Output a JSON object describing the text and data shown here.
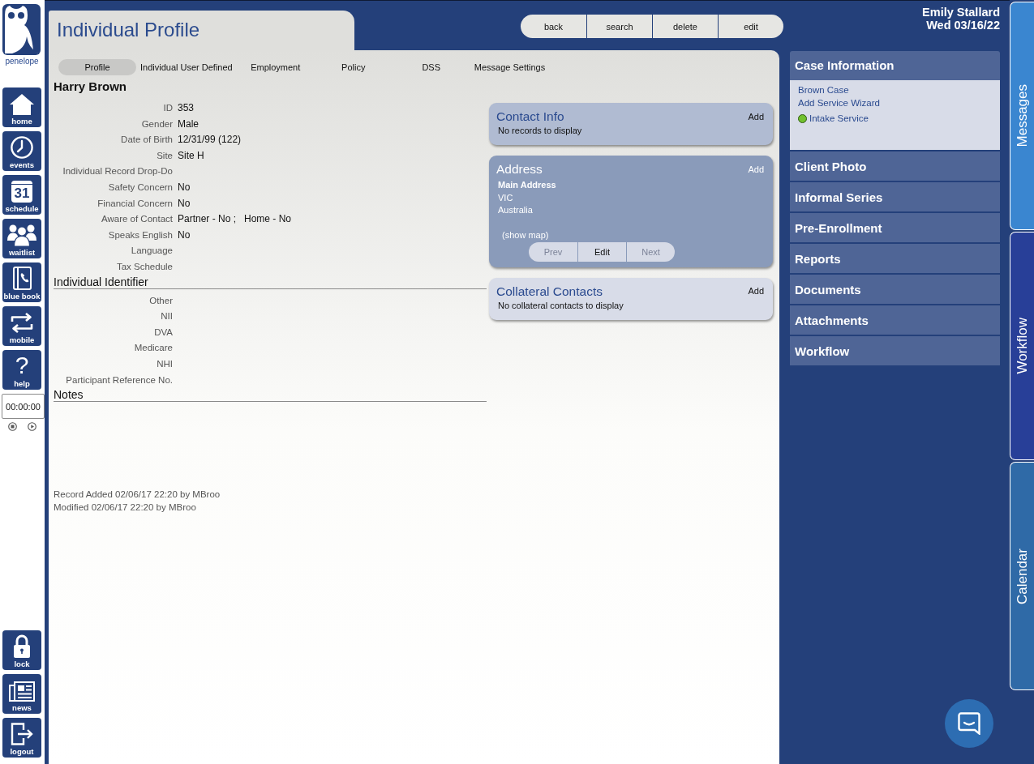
{
  "sidebar": {
    "logo_text": "penelope",
    "nav_items": [
      {
        "label": "home"
      },
      {
        "label": "events"
      },
      {
        "label": "schedule",
        "icon_text": "31"
      },
      {
        "label": "waitlist"
      },
      {
        "label": "blue book"
      },
      {
        "label": "mobile"
      },
      {
        "label": "help",
        "icon_text": "?"
      }
    ],
    "timer": {
      "value": "00:00:00"
    },
    "bottom_items": [
      {
        "label": "lock"
      },
      {
        "label": "news"
      },
      {
        "label": "logout"
      }
    ]
  },
  "header": {
    "title": "Individual Profile",
    "buttons": [
      "back",
      "search",
      "delete",
      "edit"
    ],
    "user_name": "Emily Stallard",
    "date": "Wed 03/16/22"
  },
  "profile": {
    "tabs": [
      {
        "label": "Profile",
        "selected": true
      },
      {
        "label": "Individual User Defined",
        "selected": false
      },
      {
        "label": "Employment",
        "selected": false
      },
      {
        "label": "Policy",
        "selected": false
      },
      {
        "label": "DSS",
        "selected": false
      },
      {
        "label": "Message Settings",
        "selected": false
      }
    ],
    "name": "Harry Brown",
    "sections": [
      {
        "fields": [
          {
            "label": "ID",
            "value": "353"
          },
          {
            "label": "Gender",
            "value": "Male"
          },
          {
            "label": "Date of Birth",
            "value": "12/31/99 (122)"
          },
          {
            "label": "Site",
            "value": "Site H"
          },
          {
            "label": "Individual Record Drop-Do"
          },
          {
            "label": "Safety Concern",
            "value": "No"
          },
          {
            "label": "Financial Concern",
            "value": "No"
          },
          {
            "label": "Aware of Contact",
            "value": "Partner - No ;   Home - No"
          },
          {
            "label": "Speaks English",
            "value": "No"
          },
          {
            "label": "Language"
          },
          {
            "label": "Tax Schedule"
          }
        ]
      },
      {
        "title": "Individual Identifier",
        "fields": [
          {
            "label": "Other"
          },
          {
            "label": "NII"
          },
          {
            "label": "DVA"
          },
          {
            "label": "Medicare"
          },
          {
            "label": "NHI"
          },
          {
            "label": "Participant Reference No."
          }
        ]
      },
      {
        "title": "Notes"
      }
    ],
    "audit": [
      "Record Added 02/06/17 22:20 by MBroo",
      "Modified 02/06/17 22:20 by MBroo"
    ]
  },
  "cards": [
    {
      "kind": "contact",
      "title": "Contact Info",
      "action": "Add",
      "message": "No records to display"
    },
    {
      "kind": "address",
      "title": "Address",
      "action": "Add",
      "address_label": "Main Address",
      "lines": [
        "VIC",
        "Australia"
      ],
      "map_link": "(show map)",
      "buttons": [
        {
          "label": "Prev",
          "disabled": true
        },
        {
          "label": "Edit",
          "disabled": false
        },
        {
          "label": "Next",
          "disabled": true
        }
      ]
    },
    {
      "kind": "collateral",
      "title": "Collateral Contacts",
      "action": "Add",
      "message": "No collateral contacts to display"
    }
  ],
  "case_panel": {
    "title": "Case Information",
    "links": [
      {
        "label": "Brown Case"
      },
      {
        "label": "Add Service Wizard"
      },
      {
        "label": "Intake Service",
        "color": "#72c12e"
      }
    ]
  },
  "side_menu": [
    "Client Photo",
    "Informal Series",
    "Pre-Enrollment",
    "Reports",
    "Documents",
    "Attachments",
    "Workflow"
  ],
  "side_tabs": [
    {
      "label": "Messages",
      "color": "#3a86d0"
    },
    {
      "label": "Workflow",
      "color": "#283f98"
    },
    {
      "label": "Calendar",
      "color": "#2f6aa7"
    }
  ]
}
